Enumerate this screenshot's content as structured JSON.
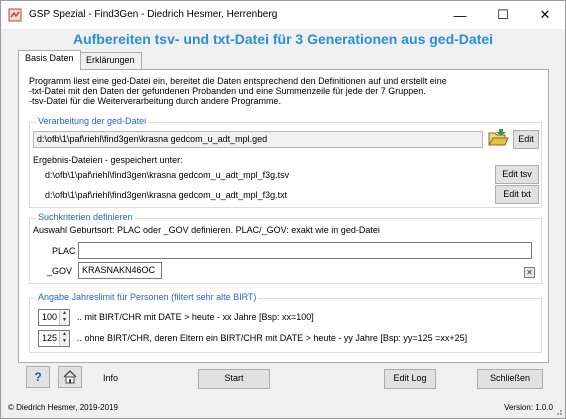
{
  "window": {
    "title": "GSP Spezial - Find3Gen  -  Diedrich Hesmer, Herrenberg",
    "minimize": "—",
    "maximize": "☐",
    "close": "✕"
  },
  "heading": "Aufbereiten tsv- und txt-Datei für 3 Generationen aus ged-Datei",
  "tabs": [
    {
      "label": "Basis Daten",
      "active": true
    },
    {
      "label": "Erklärungen",
      "active": false
    }
  ],
  "description": [
    "Programm liest eine ged-Datei ein, bereitet die Daten entsprechend den Definitionen auf und erstellt eine",
    "-txt-Datei mit den Daten der gefundenen Probanden und eine Summenzeile für jede der 7 Gruppen.",
    "-tsv-Datei für die Weiterverarbeitung durch andere Programme."
  ],
  "ged_group": {
    "legend": "Verarbeitung der ged-Datei",
    "ged_path": "d:\\ofb\\1\\paf\\riehl\\find3gen\\krasna gedcom_u_adt_mpl.ged",
    "edit_label": "Edit",
    "results_label": "Ergebnis-Dateien - gespeichert unter:",
    "tsv_path": "d:\\ofb\\1\\paf\\riehl\\find3gen\\krasna gedcom_u_adt_mpl_f3g.tsv",
    "edit_tsv_label": "Edit tsv",
    "txt_path": "d:\\ofb\\1\\paf\\riehl\\find3gen\\krasna gedcom_u_adt_mpl_f3g.txt",
    "edit_txt_label": "Edit txt"
  },
  "search_group": {
    "legend": "Suchkriterien definieren",
    "info": "Auswahl Geburtsort: PLAC oder _GOV definieren. PLAC/_GOV: exakt wie in ged-Datei",
    "plac_label": "PLAC",
    "plac_value": "",
    "gov_label": "_GOV",
    "gov_value": "KRASNAKN46OC",
    "clear_symbol": "✕"
  },
  "limit_group": {
    "legend": "Angabe Jahreslimit für Personen (filtert sehr alte BIRT)",
    "xx_value": "100",
    "xx_text": ".. mit BIRT/CHR mit DATE > heute - xx Jahre [Bsp: xx=100]",
    "yy_value": "125",
    "yy_text": ".. ohne BIRT/CHR, deren Eltern ein BIRT/CHR mit DATE > heute - yy Jahre [Bsp: yy=125 =xx+25]"
  },
  "bottom": {
    "help_symbol": "?",
    "info_label": "Info",
    "start_label": "Start",
    "edit_log_label": "Edit Log",
    "close_label": "Schließen"
  },
  "footer": {
    "copyright": "© Diedrich Hesmer, 2019-2019",
    "version": "Version:  1.0.0"
  },
  "colors": {
    "heading": "#2a8fd8",
    "legend": "#2a64c8",
    "folder": "#e8c040"
  }
}
